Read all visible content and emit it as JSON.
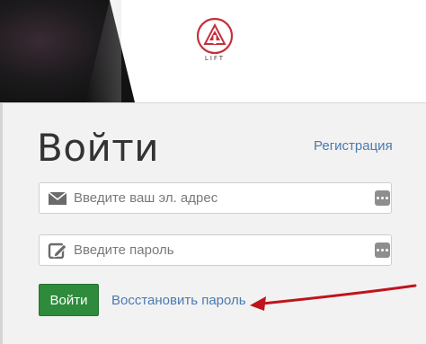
{
  "brand": {
    "logo_text": "LIFT",
    "accent_color": "#c4303a"
  },
  "login": {
    "title": "Войти",
    "register_link": "Регистрация",
    "email_placeholder": "Введите ваш эл. адрес",
    "password_placeholder": "Введите пароль",
    "submit_label": "Войти",
    "restore_link": "Восстановить пароль",
    "email_icon": "envelope-icon",
    "password_icon": "edit-icon",
    "field_menu_icon": "more-dots-icon"
  },
  "annotation": {
    "arrow_color": "#c0141c",
    "points_to": "restore_link"
  },
  "colors": {
    "link": "#4a7ab0",
    "primary_button": "#2e8b3c"
  }
}
